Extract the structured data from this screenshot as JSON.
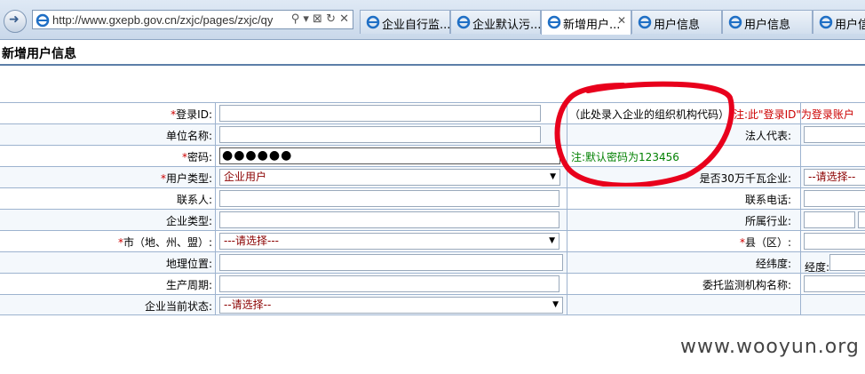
{
  "browser": {
    "address_url": "http://www.gxepb.gov.cn/zxjc/pages/zxjc/qy",
    "address_tools": "⚲ ▾ ⊠ ↻ ✕",
    "tabs": [
      {
        "label": "企业自行监...",
        "active": false
      },
      {
        "label": "企业默认污...",
        "active": false
      },
      {
        "label": "新增用户...",
        "active": true
      },
      {
        "label": "用户信息",
        "active": false
      },
      {
        "label": "用户信息",
        "active": false
      },
      {
        "label": "用户信息",
        "active": false
      }
    ],
    "tab_close": "✕"
  },
  "page": {
    "title": "新增用户信息"
  },
  "form": {
    "rows": [
      {
        "req": "*",
        "label": "登录ID:",
        "input_value": "",
        "right_label": "",
        "right_req": ""
      },
      {
        "req": "",
        "label": "单位名称:",
        "input_value": "",
        "right_label": "法人代表:",
        "right_req": ""
      },
      {
        "req": "*",
        "label": "密码:",
        "input_value": "●●●●●●",
        "right_label": "",
        "right_req": ""
      },
      {
        "req": "*",
        "label": "用户类型:",
        "select_value": "企业用户",
        "right_label": "是否30万千瓦企业:",
        "right_req": "",
        "right_select": "--请选择--"
      },
      {
        "req": "",
        "label": "联系人:",
        "input_value": "",
        "right_label": "联系电话:",
        "right_req": ""
      },
      {
        "req": "",
        "label": "企业类型:",
        "input_value": "",
        "right_label": "所属行业:",
        "right_req": ""
      },
      {
        "req": "*",
        "label": "市（地、州、盟）:",
        "select_value": "---请选择---",
        "right_label": "县（区）:",
        "right_req": "*"
      },
      {
        "req": "",
        "label": "地理位置:",
        "input_value": "",
        "right_label": "经纬度:",
        "right_req": "",
        "right_extra": "经度:"
      },
      {
        "req": "",
        "label": "生产周期:",
        "input_value": "",
        "right_label": "委托监测机构名称:",
        "right_req": ""
      },
      {
        "req": "",
        "label": "企业当前状态:",
        "select_value": "--请选择--",
        "right_label": "",
        "right_req": ""
      }
    ],
    "notes": {
      "org_code_hint": "（此处录入企业的组织机构代码）",
      "login_note": "注:此\"登录ID\"为登录账户",
      "password_note": "注:默认密码为123456"
    }
  },
  "watermark": "www.wooyun.org",
  "colors": {
    "required": "#cc0000",
    "select_text": "#8b0000",
    "password_note": "#008000",
    "highlight_circle": "#e8001c",
    "table_border": "#9db3cf"
  }
}
